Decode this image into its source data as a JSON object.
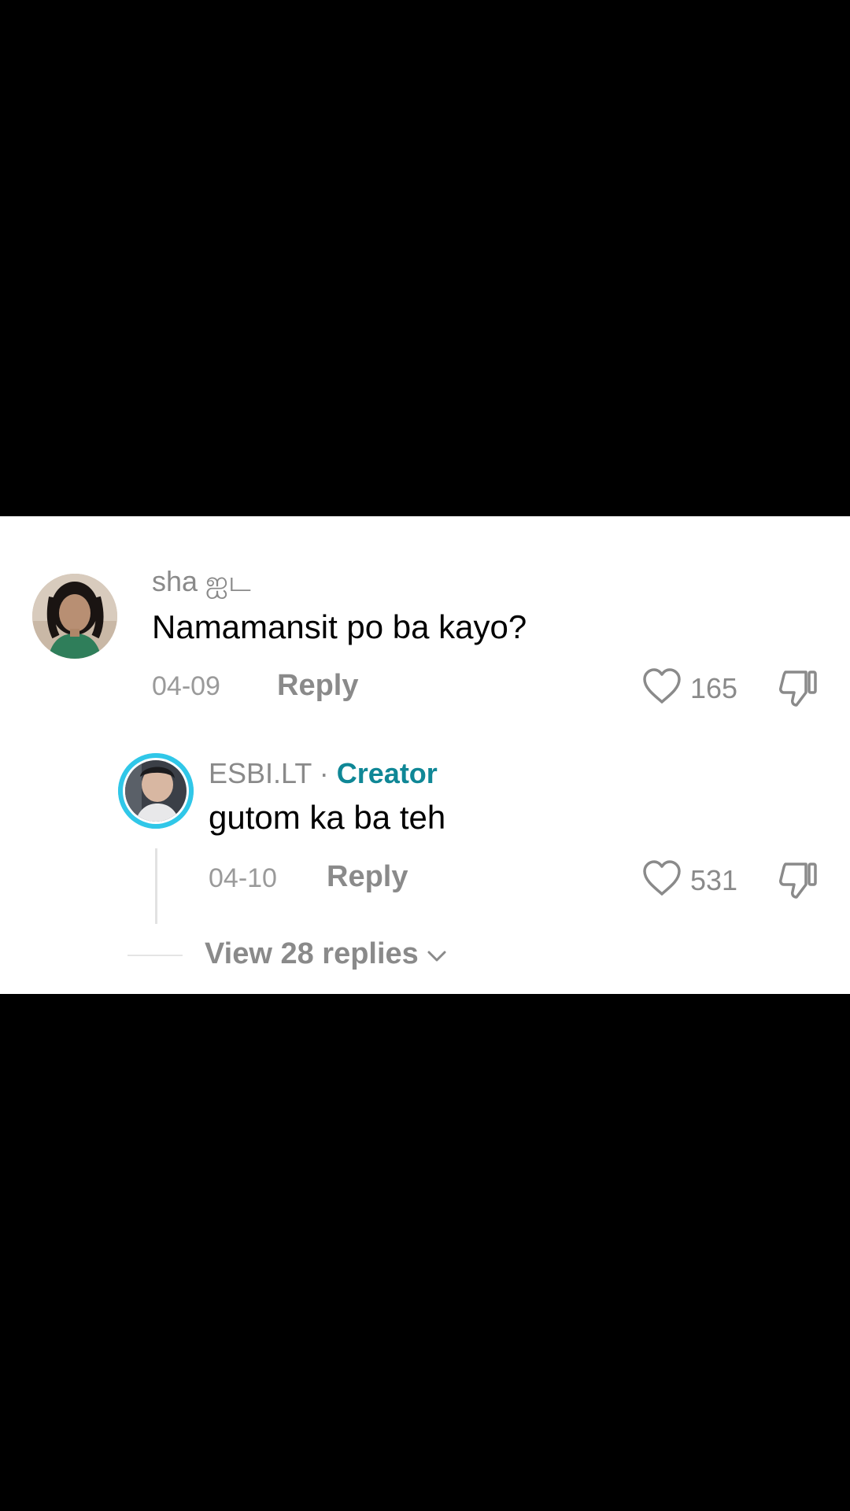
{
  "comment": {
    "username": "sha ஐட",
    "text": "Namamansit po ba kayo?",
    "date": "04-09",
    "reply_label": "Reply",
    "likes": "165",
    "avatar_icon": "user-avatar-photo"
  },
  "reply": {
    "username": "ESBI.LT",
    "separator": "·",
    "badge": "Creator",
    "text": "gutom ka ba teh",
    "date": "04-10",
    "reply_label": "Reply",
    "likes": "531",
    "avatar_icon": "creator-avatar-photo",
    "ring_color": "#30c7e8"
  },
  "thread": {
    "view_replies_label": "View 28 replies",
    "chevron_icon": "chevron-down-icon"
  },
  "icons": {
    "like": "heart-outline-icon",
    "dislike": "thumbs-down-icon"
  },
  "colors": {
    "creator_badge": "#0f8796",
    "muted_text": "#8a8a8a"
  }
}
